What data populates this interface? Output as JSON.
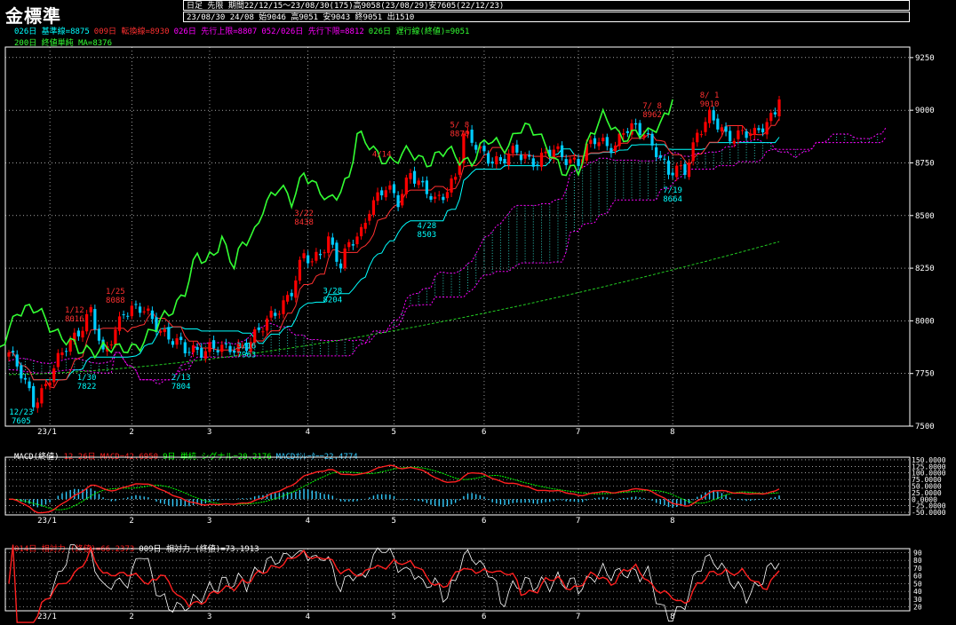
{
  "app": {
    "title": "金標準",
    "header_line1": "日足  先限  期間22/12/15～23/08/30(175)高9058(23/08/29)安7605(22/12/23)",
    "header_line2": "23/08/30 24/08 始9046 高9051 安9043 終9051 出1510"
  },
  "colors": {
    "up": "#ff0000",
    "down": "#00ccff",
    "kijun": "#00ffff",
    "tenkan": "#ff3030",
    "senkou_a": "#ff00ff",
    "senkou_b": "#ff00ff",
    "chikou": "#33ff33",
    "ma200": "#22cc22",
    "macd": "#ff2020",
    "signal": "#00ff00",
    "osc": "#33ccff",
    "rsi14": "#ff2020",
    "rsi9": "#ffffff"
  },
  "legends": {
    "main_row1": [
      {
        "text": "026日 基準線=8875",
        "color": "#00ffff"
      },
      {
        "text": "009日 転換線=8930",
        "color": "#ff3030"
      },
      {
        "text": "026日 先行上限=8807",
        "color": "#ff00ff"
      },
      {
        "text": "052/026日 先行下限=8812",
        "color": "#ff00ff"
      },
      {
        "text": "026日 遅行線(終値)=9051",
        "color": "#33ff33"
      }
    ],
    "main_row2": [
      {
        "text": "200日 終値単純 MA=8376",
        "color": "#33ff33"
      }
    ],
    "macd": [
      {
        "text": "MACD(終値)",
        "color": "#ffffff"
      },
      {
        "text": "12-26日 MACD=42.6950",
        "color": "#ff2020"
      },
      {
        "text": "9日 単純 シグナル=20.2176",
        "color": "#00ff00"
      },
      {
        "text": "MACDｵｼﾚｰﾀｰ=22.4774",
        "color": "#33ccff"
      }
    ],
    "rsi": [
      {
        "text": "014日 相対力 (終値)=66.2373",
        "color": "#ff2020"
      },
      {
        "text": "009日 相対力 (終値)=73.1913",
        "color": "#ffffff"
      }
    ]
  },
  "chart_data": [
    {
      "type": "candlestick",
      "panel": "price",
      "x_labels": [
        "23/1",
        "2",
        "3",
        "4",
        "5",
        "6",
        "7",
        "8"
      ],
      "y_ticks": [
        7500,
        7750,
        8000,
        8250,
        8500,
        8750,
        9000,
        9250
      ],
      "ylim": [
        7500,
        9300
      ],
      "close_anchors": [
        [
          0,
          7850
        ],
        [
          6,
          7620
        ],
        [
          9,
          7700
        ],
        [
          14,
          7870
        ],
        [
          20,
          8050
        ],
        [
          23,
          7820
        ],
        [
          28,
          8060
        ],
        [
          33,
          8040
        ],
        [
          38,
          7950
        ],
        [
          43,
          7850
        ],
        [
          49,
          7880
        ],
        [
          53,
          7850
        ],
        [
          58,
          7900
        ],
        [
          62,
          7960
        ],
        [
          65,
          8040
        ],
        [
          69,
          8150
        ],
        [
          72,
          8300
        ],
        [
          74,
          8270
        ],
        [
          78,
          8400
        ],
        [
          81,
          8250
        ],
        [
          83,
          8350
        ],
        [
          86,
          8430
        ],
        [
          88,
          8550
        ],
        [
          92,
          8620
        ],
        [
          95,
          8570
        ],
        [
          98,
          8720
        ],
        [
          101,
          8620
        ],
        [
          104,
          8560
        ],
        [
          109,
          8690
        ],
        [
          111,
          8870
        ],
        [
          116,
          8800
        ],
        [
          120,
          8750
        ],
        [
          124,
          8800
        ],
        [
          129,
          8760
        ],
        [
          133,
          8800
        ],
        [
          139,
          8760
        ],
        [
          143,
          8850
        ],
        [
          148,
          8840
        ],
        [
          150,
          8900
        ],
        [
          155,
          8900
        ],
        [
          158,
          8820
        ],
        [
          161,
          8690
        ],
        [
          165,
          8720
        ],
        [
          168,
          8900
        ],
        [
          171,
          8960
        ],
        [
          175,
          8880
        ],
        [
          179,
          8900
        ],
        [
          182,
          8870
        ],
        [
          185,
          8940
        ],
        [
          188,
          9051
        ]
      ],
      "annotations": [
        {
          "label": "12/23",
          "value": "7605",
          "i": 3,
          "price": 7605,
          "pos": "below",
          "color": "#00ffff"
        },
        {
          "label": "1/12",
          "value": "8016",
          "i": 16,
          "price": 7980,
          "pos": "above",
          "color": "#ff3030"
        },
        {
          "label": "1/25",
          "value": "8088",
          "i": 26,
          "price": 8070,
          "pos": "above",
          "color": "#ff3030"
        },
        {
          "label": "1/30",
          "value": "7822",
          "i": 19,
          "price": 7770,
          "pos": "below",
          "color": "#00ffff"
        },
        {
          "label": "2/13",
          "value": "7804",
          "i": 42,
          "price": 7770,
          "pos": "below",
          "color": "#00ffff"
        },
        {
          "label": "3/16",
          "value": "7963",
          "i": 58,
          "price": 7920,
          "pos": "below",
          "color": "#00ffff"
        },
        {
          "label": "3/22",
          "value": "8438",
          "i": 72,
          "price": 8440,
          "pos": "above",
          "color": "#ff3030"
        },
        {
          "label": "3/28",
          "value": "8204",
          "i": 79,
          "price": 8180,
          "pos": "below",
          "color": "#00ffff"
        },
        {
          "label": "4/14",
          "value": "",
          "i": 91,
          "price": 8720,
          "pos": "above",
          "color": "#ff3030"
        },
        {
          "label": "4/28",
          "value": "8503",
          "i": 102,
          "price": 8490,
          "pos": "below",
          "color": "#00ffff"
        },
        {
          "label": "5/ 8",
          "value": "8870",
          "i": 110,
          "price": 8860,
          "pos": "above",
          "color": "#ff3030"
        },
        {
          "label": "7/ 8",
          "value": "8962",
          "i": 157,
          "price": 8950,
          "pos": "above",
          "color": "#ff3030"
        },
        {
          "label": "7/19",
          "value": "8664",
          "i": 162,
          "price": 8660,
          "pos": "below",
          "color": "#00ffff"
        },
        {
          "label": "8/ 1",
          "value": "9010",
          "i": 171,
          "price": 9000,
          "pos": "above",
          "color": "#ff3030"
        }
      ]
    },
    {
      "type": "line",
      "panel": "macd",
      "y_ticks": [
        -50,
        -25,
        0,
        25,
        50,
        75,
        100,
        125,
        150
      ],
      "y_tick_labels": [
        "-50.0000",
        "-25.0000",
        "0.0000",
        "25.0000",
        "50.0000",
        "75.0000",
        "100.0000",
        "125.0000",
        "150.0000"
      ],
      "ylim": [
        -60,
        160
      ]
    },
    {
      "type": "line",
      "panel": "rsi",
      "y_ticks": [
        20,
        30,
        40,
        50,
        60,
        70,
        80,
        90
      ],
      "ylim": [
        15,
        95
      ]
    }
  ]
}
